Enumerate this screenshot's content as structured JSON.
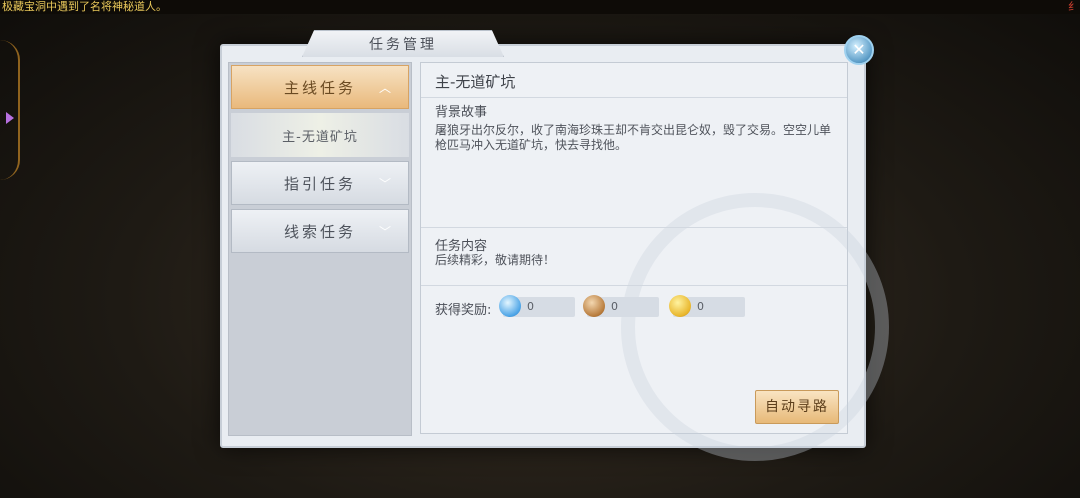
{
  "ticker": {
    "text": "极藏宝洞中遇到了名将神秘道人。",
    "right_text": "纟"
  },
  "dialog": {
    "title": "任务管理",
    "close_icon": "close-icon"
  },
  "sidebar": {
    "items": [
      {
        "label": "主线任务",
        "active": true,
        "chevron": "︿"
      },
      {
        "label": "指引任务",
        "active": false,
        "chevron": "﹀"
      },
      {
        "label": "线索任务",
        "active": false,
        "chevron": "﹀"
      }
    ],
    "sub_item": "主-无道矿坑"
  },
  "content": {
    "title": "主-无道矿坑",
    "background_label": "背景故事",
    "background_text": "屠狼牙出尔反尔，收了南海珍珠王却不肯交出昆仑奴，毁了交易。空空儿单枪匹马冲入无道矿坑，快去寻找他。",
    "task_label": "任务内容",
    "task_text": "后续精彩，敬请期待！",
    "reward_label": "获得奖励:",
    "rewards": [
      {
        "icon": "water-drop-icon",
        "value": "0"
      },
      {
        "icon": "copper-coin-icon",
        "value": "0"
      },
      {
        "icon": "gold-ingot-icon",
        "value": "0"
      }
    ],
    "auto_button": "自动寻路"
  },
  "colors": {
    "accent": "#e9b97c",
    "panel": "#e9edf2"
  }
}
